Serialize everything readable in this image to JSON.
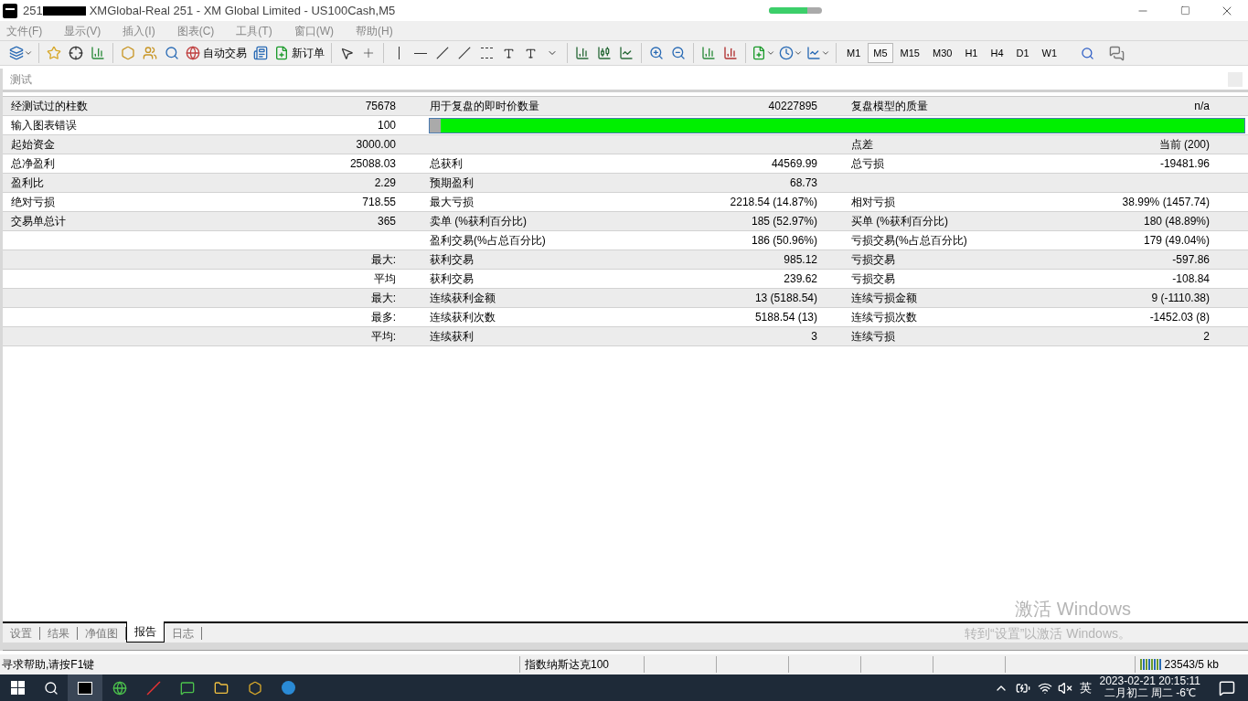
{
  "window": {
    "title_prefix": "251",
    "title": "XMGlobal-Real 251 - XM Global Limited - US100Cash,M5"
  },
  "menu": [
    "文件(F)",
    "显示(V)",
    "插入(I)",
    "图表(C)",
    "工具(T)",
    "窗口(W)",
    "帮助(H)"
  ],
  "toolbar": {
    "auto_trade": "自动交易",
    "new_order": "新订单"
  },
  "timeframes": [
    {
      "label": "M1",
      "selected": false
    },
    {
      "label": "M5",
      "selected": true
    },
    {
      "label": "M15",
      "selected": false
    },
    {
      "label": "M30",
      "selected": false
    },
    {
      "label": "H1",
      "selected": false
    },
    {
      "label": "H4",
      "selected": false
    },
    {
      "label": "D1",
      "selected": false
    },
    {
      "label": "W1",
      "selected": false
    }
  ],
  "panel": {
    "title": "测试"
  },
  "report": {
    "rows": [
      {
        "kind": "cells",
        "cells": [
          "经测试过的柱数",
          "75678",
          "用于复盘的即时价数量",
          "40227895",
          "复盘模型的质量",
          "n/a"
        ]
      },
      {
        "kind": "bar",
        "cells": [
          "输入图表错误",
          "100"
        ],
        "level": 0.987
      },
      {
        "kind": "cells",
        "cells": [
          "起始资金",
          "3000.00",
          "",
          "",
          "点差",
          "当前 (200)"
        ]
      },
      {
        "kind": "cells",
        "cells": [
          "总净盈利",
          "25088.03",
          "总获利",
          "44569.99",
          "总亏损",
          "-19481.96"
        ]
      },
      {
        "kind": "cells",
        "cells": [
          "盈利比",
          "2.29",
          "预期盈利",
          "68.73",
          "",
          ""
        ]
      },
      {
        "kind": "cells",
        "cells": [
          "绝对亏损",
          "718.55",
          "最大亏损",
          "2218.54 (14.87%)",
          "相对亏损",
          "38.99% (1457.74)"
        ]
      },
      {
        "kind": "cells",
        "cells": [
          "交易单总计",
          "365",
          "卖单 (%获利百分比)",
          "185 (52.97%)",
          "买单 (%获利百分比)",
          "180 (48.89%)"
        ]
      },
      {
        "kind": "cells",
        "cells": [
          "",
          "",
          "盈利交易(%占总百分比)",
          "186 (50.96%)",
          "亏损交易(%占总百分比)",
          "179 (49.04%)"
        ]
      },
      {
        "kind": "cells",
        "cells": [
          "",
          "最大:",
          "获利交易",
          "985.12",
          "亏损交易",
          "-597.86"
        ]
      },
      {
        "kind": "cells",
        "cells": [
          "",
          "平均",
          "获利交易",
          "239.62",
          "亏损交易",
          "-108.84"
        ]
      },
      {
        "kind": "cells",
        "cells": [
          "",
          "最大:",
          "连续获利金额",
          "13 (5188.54)",
          "连续亏损金额",
          "9 (-1110.38)"
        ]
      },
      {
        "kind": "cells",
        "cells": [
          "",
          "最多:",
          "连续获利次数",
          "5188.54 (13)",
          "连续亏损次数",
          "-1452.03 (8)"
        ]
      },
      {
        "kind": "cells",
        "cells": [
          "",
          "平均:",
          "连续获利",
          "3",
          "连续亏损",
          "2"
        ]
      }
    ]
  },
  "tabs": [
    {
      "label": "设置",
      "selected": false
    },
    {
      "label": "结果",
      "selected": false
    },
    {
      "label": "净值图",
      "selected": false
    },
    {
      "label": "报告",
      "selected": true
    },
    {
      "label": "日志",
      "selected": false
    }
  ],
  "activation": {
    "title": "激活 Windows",
    "subtitle": "转到“设置”以激活 Windows。"
  },
  "status_bar": {
    "help": "寻求帮助,请按F1键",
    "symbol": "指数纳斯达克100",
    "traffic": "23543/5 kb"
  },
  "taskbar": {
    "ime": "英",
    "datetime": "2023-02-21 20:15:11",
    "date_info": "二月初二 周二 -6℃"
  }
}
